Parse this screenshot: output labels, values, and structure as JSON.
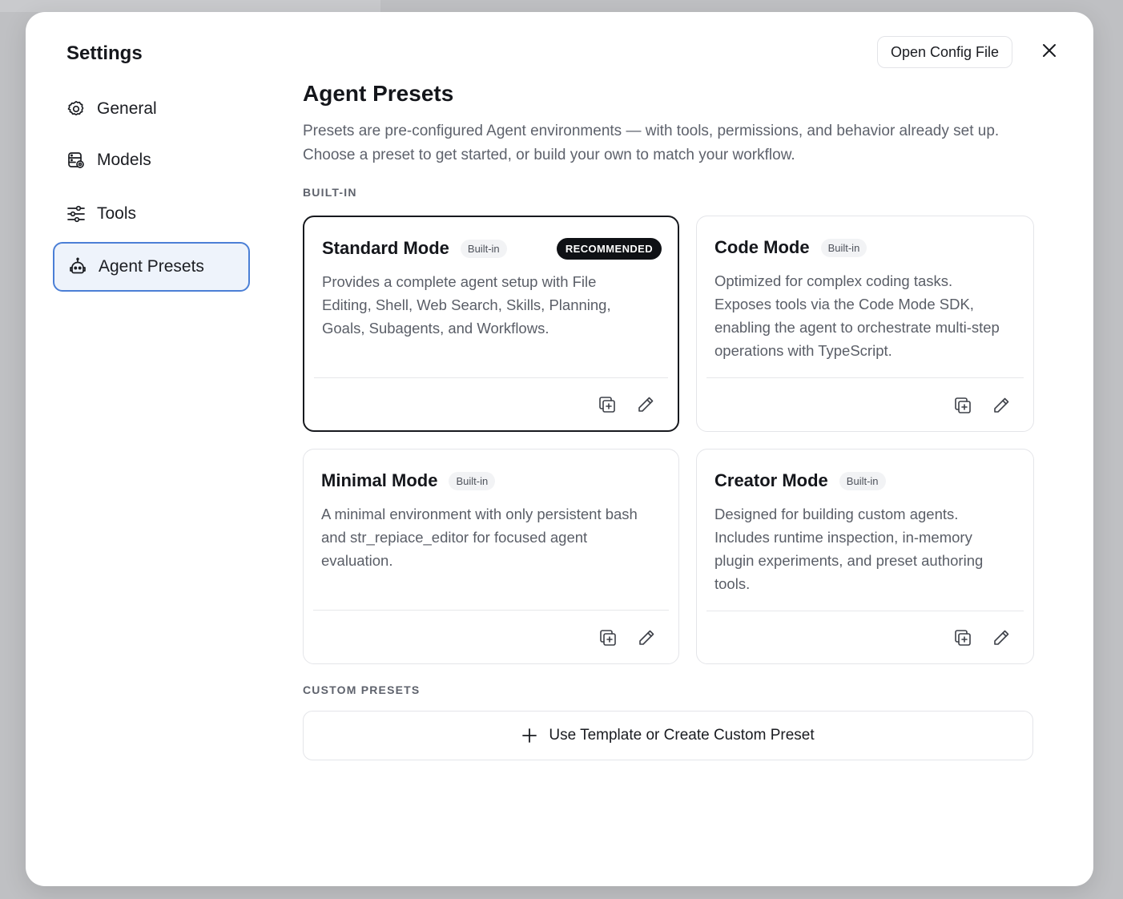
{
  "settings": {
    "title": "Settings"
  },
  "sidebar": {
    "items": [
      {
        "label": "General",
        "icon": "gear-icon"
      },
      {
        "label": "Models",
        "icon": "database-icon"
      },
      {
        "label": "Tools",
        "icon": "sliders-icon"
      },
      {
        "label": "Agent Presets",
        "icon": "robot-icon",
        "active": true
      }
    ]
  },
  "header": {
    "open_config_label": "Open Config File",
    "close_icon": "close-icon"
  },
  "main": {
    "title": "Agent Presets",
    "description": "Presets are pre-configured Agent environments — with tools, permissions, and behavior already set up. Choose a preset to get started, or build your own to match your workflow.",
    "builtin_label": "BUILT-IN",
    "custom_label": "CUSTOM PRESETS",
    "create_label": "Use Template or Create Custom Preset",
    "presets": [
      {
        "name": "Standard Mode",
        "badge": "Built-in",
        "recommended": "RECOMMENDED",
        "description": "Provides a complete agent setup with File Editing, Shell, Web Search, Skills, Planning, Goals, Subagents, and Workflows."
      },
      {
        "name": "Code Mode",
        "badge": "Built-in",
        "description": "Optimized for complex coding tasks. Exposes tools via the Code Mode SDK, enabling the agent to orchestrate multi-step operations with TypeScript."
      },
      {
        "name": "Minimal Mode",
        "badge": "Built-in",
        "description": "A minimal environment with only persistent bash and str_repiace_editor for focused agent evaluation."
      },
      {
        "name": "Creator Mode",
        "badge": "Built-in",
        "description": "Designed for building custom agents. Includes runtime inspection, in-memory plugin experiments, and preset authoring tools."
      }
    ]
  },
  "colors": {
    "accent": "#4b7fd6",
    "active_bg": "#eef3fb",
    "recommended_bg": "#0f1115"
  }
}
